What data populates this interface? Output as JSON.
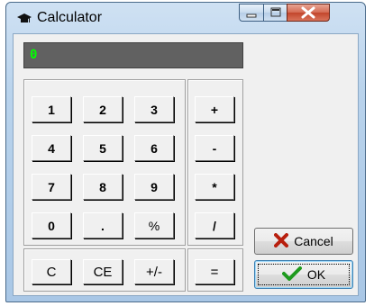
{
  "window": {
    "title": "Calculator",
    "icon": "graduation-cap-icon",
    "controls": [
      "minimize-icon",
      "maximize-icon",
      "close-icon"
    ]
  },
  "display": {
    "value": "0"
  },
  "digits": {
    "k1": "1",
    "k2": "2",
    "k3": "3",
    "k4": "4",
    "k5": "5",
    "k6": "6",
    "k7": "7",
    "k8": "8",
    "k9": "9",
    "k0": "0",
    "dot": ".",
    "percent": "%"
  },
  "functions": {
    "clear": "C",
    "clear_entry": "CE",
    "sign": "+/-"
  },
  "operators": {
    "add": "+",
    "subtract": "-",
    "multiply": "*",
    "divide": "/",
    "equals": "="
  },
  "actions": {
    "cancel_label": "Cancel",
    "cancel_icon": "red-x-icon",
    "ok_label": "OK",
    "ok_icon": "green-check-icon"
  },
  "colors": {
    "display_bg": "#616161",
    "display_text": "#00ff00",
    "close_button": "#c2452b"
  }
}
